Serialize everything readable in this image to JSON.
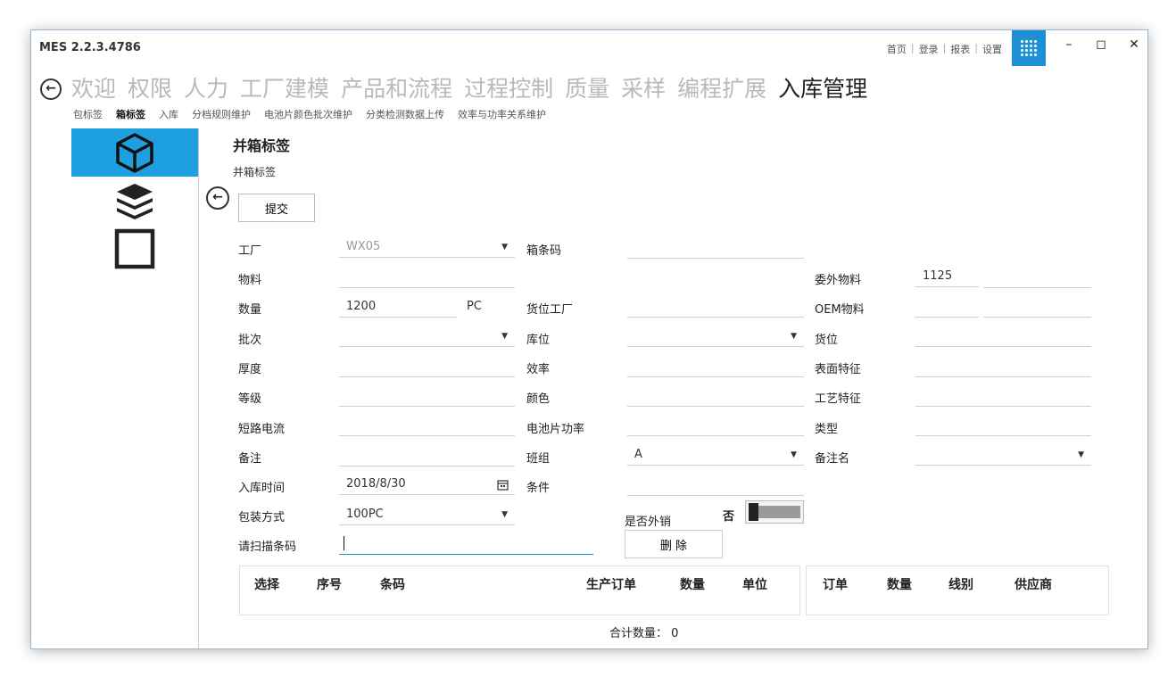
{
  "window": {
    "title": "MES 2.2.3.4786"
  },
  "toplinks": [
    "首页",
    "登录",
    "报表",
    "设置"
  ],
  "window_controls": {
    "minimize": "–",
    "maximize": "◻",
    "close": "✕"
  },
  "modules": [
    "欢迎",
    "权限",
    "人力",
    "工厂建模",
    "产品和流程",
    "过程控制",
    "质量",
    "采样",
    "编程扩展",
    "入库管理"
  ],
  "active_module": "入库管理",
  "subtabs": [
    "包标签",
    "箱标签",
    "入库",
    "分档规则维护",
    "电池片颜色批次维护",
    "分类检测数据上传",
    "效率与功率关系维护"
  ],
  "active_subtab": "箱标签",
  "form": {
    "title": "并箱标签",
    "subtitle": "并箱标签",
    "submit_label": "提交",
    "fields": {
      "factory": {
        "label": "工厂",
        "value": "WX05"
      },
      "box_barcode": {
        "label": "箱条码",
        "value": ""
      },
      "material": {
        "label": "物料",
        "value": ""
      },
      "outsource_material": {
        "label": "委外物料",
        "value": "1125",
        "value2": ""
      },
      "quantity": {
        "label": "数量",
        "value": "1200",
        "unit": "PC"
      },
      "location_factory": {
        "label": "货位工厂",
        "value": ""
      },
      "oem_material": {
        "label": "OEM物料",
        "value": "",
        "value2": ""
      },
      "batch": {
        "label": "批次",
        "value": ""
      },
      "warehouse": {
        "label": "库位",
        "value": ""
      },
      "location": {
        "label": "货位",
        "value": ""
      },
      "thickness": {
        "label": "厚度",
        "value": ""
      },
      "efficiency": {
        "label": "效率",
        "value": ""
      },
      "surface": {
        "label": "表面特征",
        "value": ""
      },
      "grade": {
        "label": "等级",
        "value": ""
      },
      "color": {
        "label": "颜色",
        "value": ""
      },
      "process": {
        "label": "工艺特征",
        "value": ""
      },
      "short_current": {
        "label": "短路电流",
        "value": ""
      },
      "cell_power": {
        "label": "电池片功率",
        "value": ""
      },
      "type": {
        "label": "类型",
        "value": ""
      },
      "remark": {
        "label": "备注",
        "value": ""
      },
      "team": {
        "label": "班组",
        "value": "A"
      },
      "remark_name": {
        "label": "备注名",
        "value": ""
      },
      "in_time": {
        "label": "入库时间",
        "value": "2018/8/30"
      },
      "condition": {
        "label": "条件",
        "value": ""
      },
      "packing": {
        "label": "包装方式",
        "value": "100PC"
      },
      "export": {
        "label": "是否外销",
        "toggle_label": "否"
      },
      "scan": {
        "label": "请扫描条码",
        "value": ""
      }
    },
    "delete_label": "删 除"
  },
  "table_left": {
    "headers": [
      "选择",
      "序号",
      "条码",
      "生产订单",
      "数量",
      "单位"
    ]
  },
  "table_right": {
    "headers": [
      "订单",
      "数量",
      "线别",
      "供应商"
    ]
  },
  "total": {
    "label": "合计数量：",
    "value": "0"
  }
}
